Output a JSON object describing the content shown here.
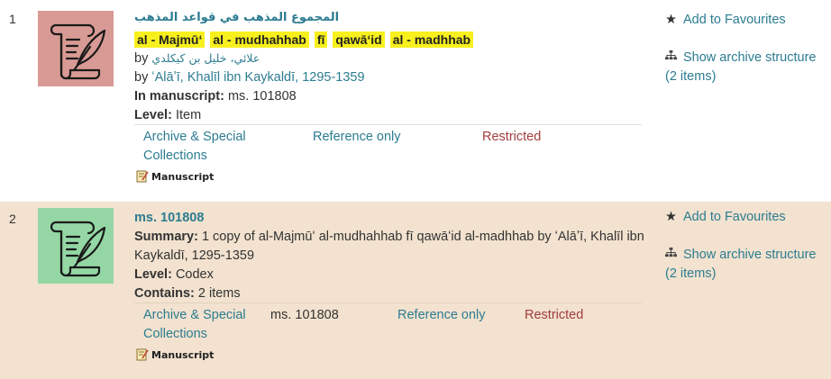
{
  "results": [
    {
      "number": "1",
      "title_arabic": "المجموع المذهب في قواعد المذهب",
      "title_words": [
        "al - Majmūʻ",
        "al - mudhahhab",
        "fī",
        "qawāʻid",
        "al - madhhab"
      ],
      "by_label": "by",
      "author_arabic": "علائي، خليل بن كيكلدي",
      "author_latin": "ʻAlāʼī, Khalīl ibn Kaykaldī, 1295-1359",
      "in_manuscript_label": "In manuscript:",
      "in_manuscript_value": "ms. 101808",
      "level_label": "Level:",
      "level_value": "Item",
      "location": "Archive & Special Collections",
      "access": "Reference only",
      "status": "Restricted",
      "format": "Manuscript",
      "thumb_color": "#d89a94",
      "favourite": "Add to Favourites",
      "archive_structure": "Show archive structure (2 items)"
    },
    {
      "number": "2",
      "title": "ms. 101808",
      "summary_label": "Summary:",
      "summary_text": "1 copy of al-Majmūʻ al-mudhahhab fī qawāʻid al-madhhab by ʻAlāʼī, Khalīl ibn Kaykaldī, 1295-1359",
      "level_label": "Level:",
      "level_value": "Codex",
      "contains_label": "Contains:",
      "contains_value": "2 items",
      "location": "Archive & Special Collections",
      "shelfmark": "ms. 101808",
      "access": "Reference only",
      "status": "Restricted",
      "format": "Manuscript",
      "thumb_color": "#94d7a5",
      "favourite": "Add to Favourites",
      "archive_structure": "Show archive structure (2 items)"
    }
  ],
  "colors": {
    "link": "#2c7c91",
    "restricted": "#a23d3d",
    "highlight": "#f7f01e",
    "row2_bg": "#f2e2cf"
  },
  "icons": {
    "favourite": "star-icon",
    "archive": "sitemap-icon",
    "thumbnail": "scroll-quill-icon",
    "format": "manuscript-icon"
  }
}
